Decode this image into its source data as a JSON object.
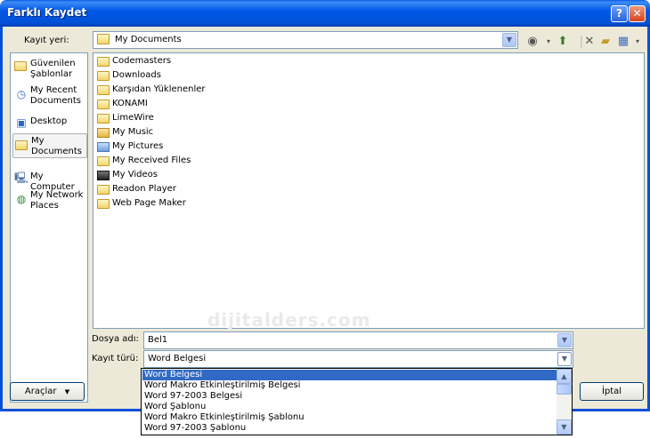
{
  "window": {
    "title": "Farklı Kaydet",
    "help_label": "?",
    "close_label": "✕"
  },
  "location": {
    "label": "Kayıt yeri:",
    "value": "My Documents"
  },
  "places": [
    {
      "label": "Güvenilen Şablonlar",
      "icon": "trusted-templates-icon"
    },
    {
      "label": "My Recent Documents",
      "icon": "recent-documents-icon"
    },
    {
      "label": "Desktop",
      "icon": "desktop-icon"
    },
    {
      "label": "My Documents",
      "icon": "my-documents-icon"
    },
    {
      "label": "My Computer",
      "icon": "my-computer-icon"
    },
    {
      "label": "My Network Places",
      "icon": "network-places-icon"
    }
  ],
  "files": [
    {
      "name": "Codemasters",
      "icon": "folder-icon"
    },
    {
      "name": "Downloads",
      "icon": "folder-icon"
    },
    {
      "name": "Karşıdan Yüklenenler",
      "icon": "folder-icon"
    },
    {
      "name": "KONAMI",
      "icon": "folder-icon"
    },
    {
      "name": "LimeWire",
      "icon": "folder-icon"
    },
    {
      "name": "My Music",
      "icon": "music-folder-icon"
    },
    {
      "name": "My Pictures",
      "icon": "pictures-folder-icon"
    },
    {
      "name": "My Received Files",
      "icon": "folder-icon"
    },
    {
      "name": "My Videos",
      "icon": "videos-folder-icon"
    },
    {
      "name": "Readon Player",
      "icon": "folder-icon"
    },
    {
      "name": "Web Page Maker",
      "icon": "folder-icon"
    }
  ],
  "watermark": "dijitalders.com",
  "filename": {
    "label": "Dosya adı:",
    "value": "Bel1"
  },
  "filetype": {
    "label": "Kayıt türü:",
    "value": "Word Belgesi",
    "options": [
      "Word Belgesi",
      "Word Makro Etkinleştirilmiş Belgesi",
      "Word 97-2003 Belgesi",
      "Word Şablonu",
      "Word Makro Etkinleştirilmiş Şablonu",
      "Word 97-2003 Şablonu"
    ]
  },
  "buttons": {
    "tools": "Araçlar",
    "cancel": "İptal"
  },
  "colors": {
    "titlebar": "#0251d8",
    "selection": "#316ac5",
    "dialog_bg": "#ece9d8"
  }
}
